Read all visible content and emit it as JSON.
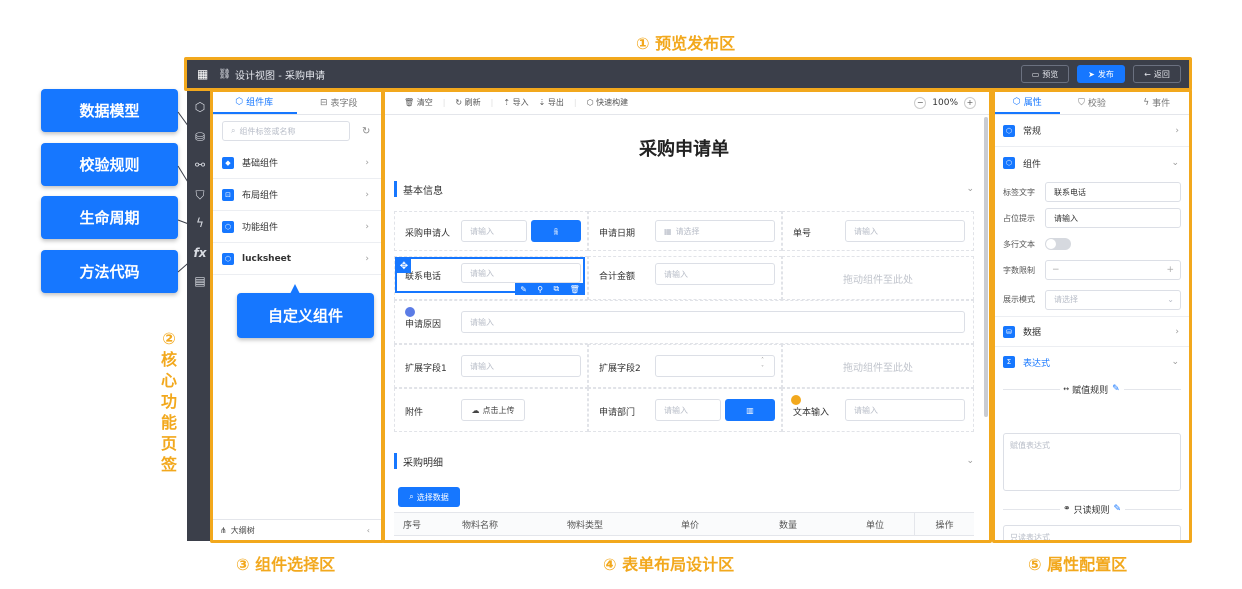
{
  "annotations": {
    "preview_publish": "① 预览发布区",
    "core_nav": "②核心功能页签",
    "component_select": "③ 组件选择区",
    "form_layout": "④ 表单布局设计区",
    "property_config": "⑤ 属性配置区"
  },
  "callouts": {
    "data_model": "数据模型",
    "validation": "校验规则",
    "lifecycle": "生命周期",
    "method_code": "方法代码",
    "custom_component": "自定义组件"
  },
  "topbar": {
    "title": "设计视图 - 采购申请",
    "preview": "预览",
    "publish": "发布",
    "back": "返回"
  },
  "left_panel": {
    "tabs": [
      "组件库",
      "表字段"
    ],
    "search_placeholder": "组件标签或名称",
    "groups": [
      "基础组件",
      "布局组件",
      "功能组件",
      "lucksheet"
    ],
    "outline": "大纲树"
  },
  "toolbar": {
    "clear": "清空",
    "refresh": "刷新",
    "import": "导入",
    "export": "导出",
    "quick_build": "快速构建",
    "zoom": "100%"
  },
  "form": {
    "title": "采购申请单",
    "section_basic": "基本信息",
    "section_detail": "采购明细",
    "labels": {
      "applicant": "采购申请人",
      "apply_date": "申请日期",
      "order_no": "单号",
      "phone": "联系电话",
      "total": "合计金额",
      "reason": "申请原因",
      "ext1": "扩展字段1",
      "ext2": "扩展字段2",
      "attachment": "附件",
      "dept": "申请部门",
      "text_input": "文本输入"
    },
    "ph_input": "请输入",
    "ph_select": "请选择",
    "drop_hint": "拖动组件至此处",
    "upload": "点击上传",
    "select_data": "选择数据",
    "table_headers": [
      "序号",
      "物料名称",
      "物料类型",
      "单价",
      "数量",
      "单位",
      "操作"
    ]
  },
  "right_panel": {
    "tabs": [
      "属性",
      "校验",
      "事件"
    ],
    "sections": {
      "regular": "常规",
      "component": "组件",
      "data": "数据",
      "expression": "表达式"
    },
    "props": {
      "label_text": "标签文字",
      "label_value": "联系电话",
      "placeholder": "占位提示",
      "placeholder_value": "请输入",
      "multiline": "多行文本",
      "char_limit": "字数限制",
      "display_mode": "展示模式",
      "display_value": "请选择"
    },
    "assign_rule": "赋值规则",
    "assign_placeholder": "赋值表达式",
    "readonly_rule": "只读规则",
    "readonly_placeholder": "只读表达式"
  },
  "colors": {
    "accent": "#1677ff",
    "annotation": "#f2a81d",
    "topbar": "#3b3f4a"
  }
}
